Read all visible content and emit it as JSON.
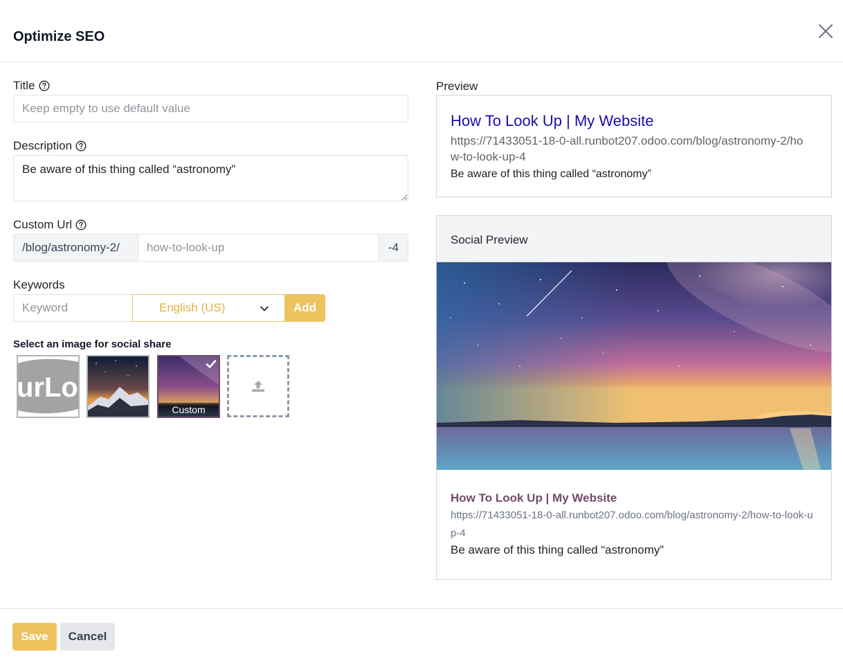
{
  "modal": {
    "title": "Optimize SEO"
  },
  "form": {
    "title_label": "Title",
    "title_value": "",
    "title_placeholder": "Keep empty to use default value",
    "description_label": "Description",
    "description_value": "Be aware of this thing called “astronomy”",
    "custom_url_label": "Custom Url",
    "url_prefix": "/blog/astronomy-2/",
    "url_slug_value": "",
    "url_slug_placeholder": "how-to-look-up",
    "url_suffix": "-4",
    "keywords_label": "Keywords",
    "keyword_value": "",
    "keyword_placeholder": "Keyword",
    "language_selected": "English (US)",
    "add_label": "Add"
  },
  "images": {
    "section_title": "Select an image for social share",
    "tiles": [
      {
        "name": "logo",
        "logo_text": "urLo"
      },
      {
        "name": "mountain-night"
      },
      {
        "name": "milky-way",
        "label": "Custom",
        "selected": true
      }
    ],
    "upload_icon": "upload-icon"
  },
  "preview": {
    "label": "Preview",
    "title": "How To Look Up | My Website",
    "url": "https://71433051-18-0-all.runbot207.odoo.com/blog/astronomy-2/how-to-look-up-4",
    "description": "Be aware of this thing called “astronomy”"
  },
  "social_preview": {
    "label": "Social Preview",
    "title": "How To Look Up | My Website",
    "url": "https://71433051-18-0-all.runbot207.odoo.com/blog/astronomy-2/how-to-look-up-4",
    "description": "Be aware of this thing called “astronomy”"
  },
  "footer": {
    "save_label": "Save",
    "cancel_label": "Cancel"
  },
  "colors": {
    "accent": "#ecc35f",
    "link_blue": "#1a0dab",
    "brand_purple": "#714b67"
  }
}
